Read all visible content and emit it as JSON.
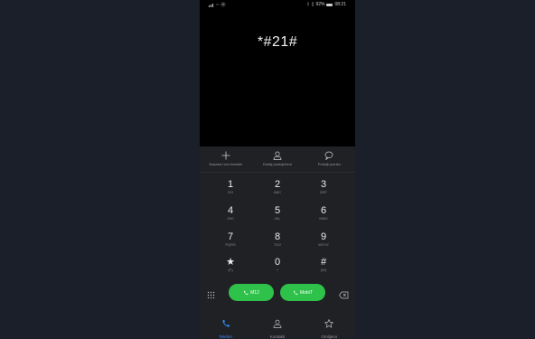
{
  "status_bar": {
    "left_text": "Ⓜ",
    "battery": "92%",
    "time": "08:21"
  },
  "display": {
    "number": "*#21#"
  },
  "actions": [
    {
      "label": "Napravi novi kontakt",
      "icon": "plus-icon"
    },
    {
      "label": "Dodaj postojećem",
      "icon": "person-icon"
    },
    {
      "label": "Pošalji poruku",
      "icon": "message-icon"
    }
  ],
  "keys": [
    {
      "digit": "1",
      "letters": "GO"
    },
    {
      "digit": "2",
      "letters": "ABC"
    },
    {
      "digit": "3",
      "letters": "DEF"
    },
    {
      "digit": "4",
      "letters": "GHI"
    },
    {
      "digit": "5",
      "letters": "JKL"
    },
    {
      "digit": "6",
      "letters": "MNO"
    },
    {
      "digit": "7",
      "letters": "PQRS"
    },
    {
      "digit": "8",
      "letters": "TUV"
    },
    {
      "digit": "9",
      "letters": "WXYZ"
    },
    {
      "digit": "★",
      "letters": "(P)"
    },
    {
      "digit": "0",
      "letters": "+"
    },
    {
      "digit": "#",
      "letters": "(W)"
    }
  ],
  "calls": {
    "sim1_label": "M12",
    "sim2_label": "MobiT"
  },
  "tabs": [
    {
      "label": "Telefon",
      "active": true
    },
    {
      "label": "Kontakti",
      "active": false
    },
    {
      "label": "Omiljeno",
      "active": false
    }
  ],
  "colors": {
    "accent": "#2f8fff",
    "call_green": "#2fc24a"
  }
}
